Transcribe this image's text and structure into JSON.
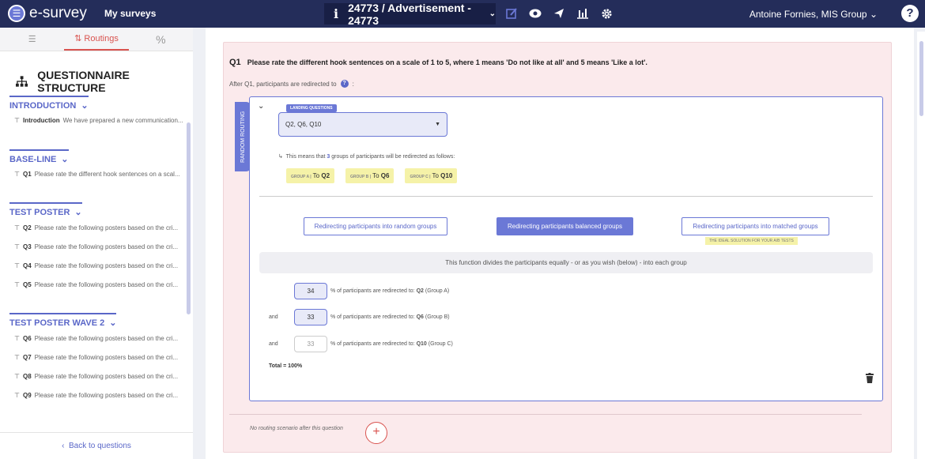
{
  "header": {
    "brand": "e-survey",
    "my_surveys": "My surveys",
    "survey_title": "24773 / Advertisement - 24773",
    "user": "Antoine Fornies, MIS Group",
    "help": "?"
  },
  "sidebar": {
    "tabs": [
      "Routings"
    ],
    "title": "QUESTIONNAIRE STRUCTURE",
    "sections": [
      {
        "name": "INTRODUCTION",
        "items": [
          {
            "code": "Introduction",
            "text": "We have prepared a new communication..."
          }
        ]
      },
      {
        "name": "BASE-LINE",
        "items": [
          {
            "code": "Q1",
            "text": "Please rate the different hook sentences on a scal..."
          }
        ]
      },
      {
        "name": "TEST POSTER",
        "items": [
          {
            "code": "Q2",
            "text": "Please rate the following posters based on the cri..."
          },
          {
            "code": "Q3",
            "text": "Please rate the following posters based on the cri..."
          },
          {
            "code": "Q4",
            "text": "Please rate the following posters based on the cri..."
          },
          {
            "code": "Q5",
            "text": "Please rate the following posters based on the cri..."
          }
        ]
      },
      {
        "name": "TEST POSTER WAVE 2",
        "items": [
          {
            "code": "Q6",
            "text": "Please rate the following posters based on the cri..."
          },
          {
            "code": "Q7",
            "text": "Please rate the following posters based on the cri..."
          },
          {
            "code": "Q8",
            "text": "Please rate the following posters based on the cri..."
          },
          {
            "code": "Q9",
            "text": "Please rate the following posters based on the cri..."
          }
        ]
      }
    ],
    "back": "Back to questions"
  },
  "question": {
    "number": "Q1",
    "text": "Please rate the different hook sentences on a scale of 1 to 5, where 1 means 'Do not like at all' and 5 means 'Like a lot'.",
    "after": "After Q1, participants are redirected to"
  },
  "routing": {
    "side_label": "RANDOM ROUTING",
    "landing_label": "LANDING QUESTIONS",
    "landing_value": "Q2, Q6, Q10",
    "means_prefix": "This means that",
    "means_count": "3",
    "means_suffix": "groups of participants will be redirected as follows:",
    "groups": [
      {
        "tag": "GROUP A |",
        "to": "To",
        "q": "Q2"
      },
      {
        "tag": "GROUP B |",
        "to": "To",
        "q": "Q6"
      },
      {
        "tag": "GROUP C |",
        "to": "To",
        "q": "Q10"
      }
    ],
    "btn_random": "Redirecting participants into random groups",
    "btn_balanced": "Redirecting participants balanced groups",
    "btn_matched": "Redirecting participants into matched groups",
    "ideal": "THE IDEAL SOLUTION FOR YOUR A/B TESTS",
    "description": "This function divides the participants equally - or as you wish (below) - into each group",
    "rows": [
      {
        "prefix": "",
        "value": "34",
        "text": "% of participants are redirected to:",
        "q": "Q2",
        "grp": "(Group A)"
      },
      {
        "prefix": "and",
        "value": "33",
        "text": "% of participants are redirected to:",
        "q": "Q6",
        "grp": "(Group B)"
      },
      {
        "prefix": "and",
        "value": "33",
        "text": "% of participants are redirected to:",
        "q": "Q10",
        "grp": "(Group C)"
      }
    ],
    "total": "Total = 100%"
  },
  "footer": {
    "no_routing": "No routing scenario after this question",
    "add": "+"
  },
  "colors": {
    "navy": "#242d5a",
    "accent": "#6b78d6",
    "red": "#d9534f",
    "card_bg": "#fbeaec",
    "yellow": "#f5f2a8"
  }
}
